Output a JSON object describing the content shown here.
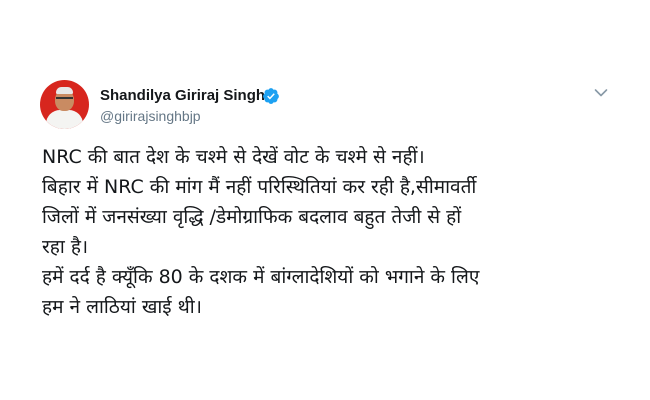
{
  "tweet": {
    "author": {
      "display_name": "Shandilya Giriraj Singh",
      "handle": "@girirajsinghbjp",
      "verified": true
    },
    "text_lines": [
      "NRC की बात देश के चश्मे से देखें वोट के चश्मे  से नहीं।",
      "बिहार में NRC की मांग मैं नहीं परिस्थितियां कर रही है,सीमावर्ती",
      "जिलों में जनसंख्या वृद्धि /डेमोग्राफिक बदलाव बहुत तेजी से हों",
      "रहा है।",
      "हमें दर्द है क्यूँकि 80 के दशक में बांग्लादेशियों को भगाने के लिए",
      "हम ने लाठियां खाई थी।"
    ]
  },
  "icons": {
    "verified": "verified-badge-icon",
    "menu": "chevron-down-icon",
    "avatar": "profile-photo"
  },
  "colors": {
    "verified_blue": "#1da1f2",
    "handle_gray": "#657786",
    "text": "#14171a",
    "avatar_bg": "#d7261e"
  }
}
